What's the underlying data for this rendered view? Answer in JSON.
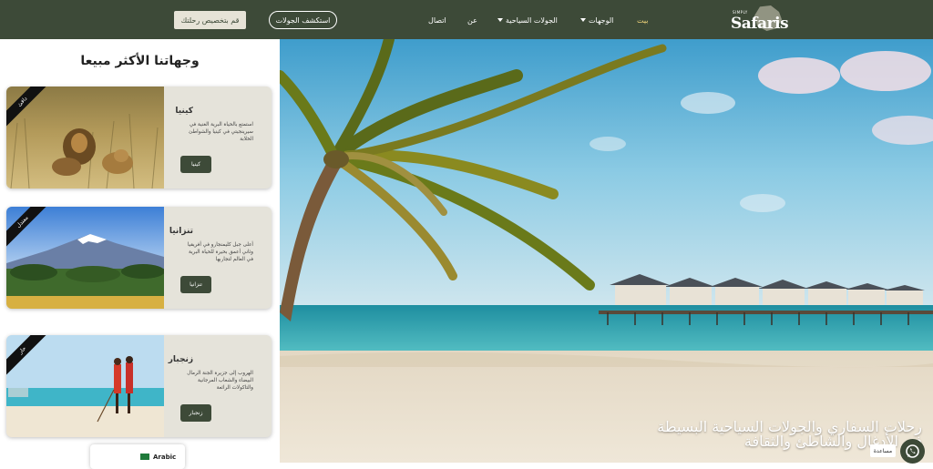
{
  "header": {
    "customize_label": "قم بتخصيص رحلتك",
    "explore_label": "استكشف الجولات",
    "nav": {
      "home": "بيت",
      "destinations": "الوجهات",
      "tours": "الجولات السياحية",
      "about": "عن",
      "contact": "اتصال"
    },
    "logo": {
      "small": "SIMPLY",
      "main": "Safaris"
    }
  },
  "left_panel": {
    "title": "وجهاتنا الأكثر مبيعا",
    "cards": [
      {
        "ribbon": "دافئ",
        "name": "كينيا",
        "description": "استمتع بالحياة البرية الغنية في سيرينجيتي في كينيا والشواطئ الخلابة",
        "button": "كينيا"
      },
      {
        "ribbon": "معتدل",
        "name": "تنزانيا",
        "description": "أعلى جبل كليمنجارو في أفريقيا وثاني أعمق بحيرة للحياة البرية في العالم لتجاربها",
        "button": "تنزانيا"
      },
      {
        "ribbon": "حار",
        "name": "زنجبار",
        "description": "الهروب إلى جزيرة الجنة الرمال البيضاء والشعاب المرجانية والتاكولات الرائعة",
        "button": "زنجبار"
      }
    ],
    "language": {
      "label": "Arabic",
      "flag_icon": "saudi-flag-icon"
    }
  },
  "hero": {
    "line1": "رحلات السفاري والجولات السياحية البسيطة",
    "line2": "في الأدغال والشاطئ والثقافة",
    "chat_label": "مساعدة",
    "chat_icon": "whatsapp-icon"
  },
  "colors": {
    "header_bg": "#3d4a38",
    "active_nav": "#f1d57a",
    "card_bg": "#e5e3da",
    "button_bg": "#3d4a38"
  }
}
